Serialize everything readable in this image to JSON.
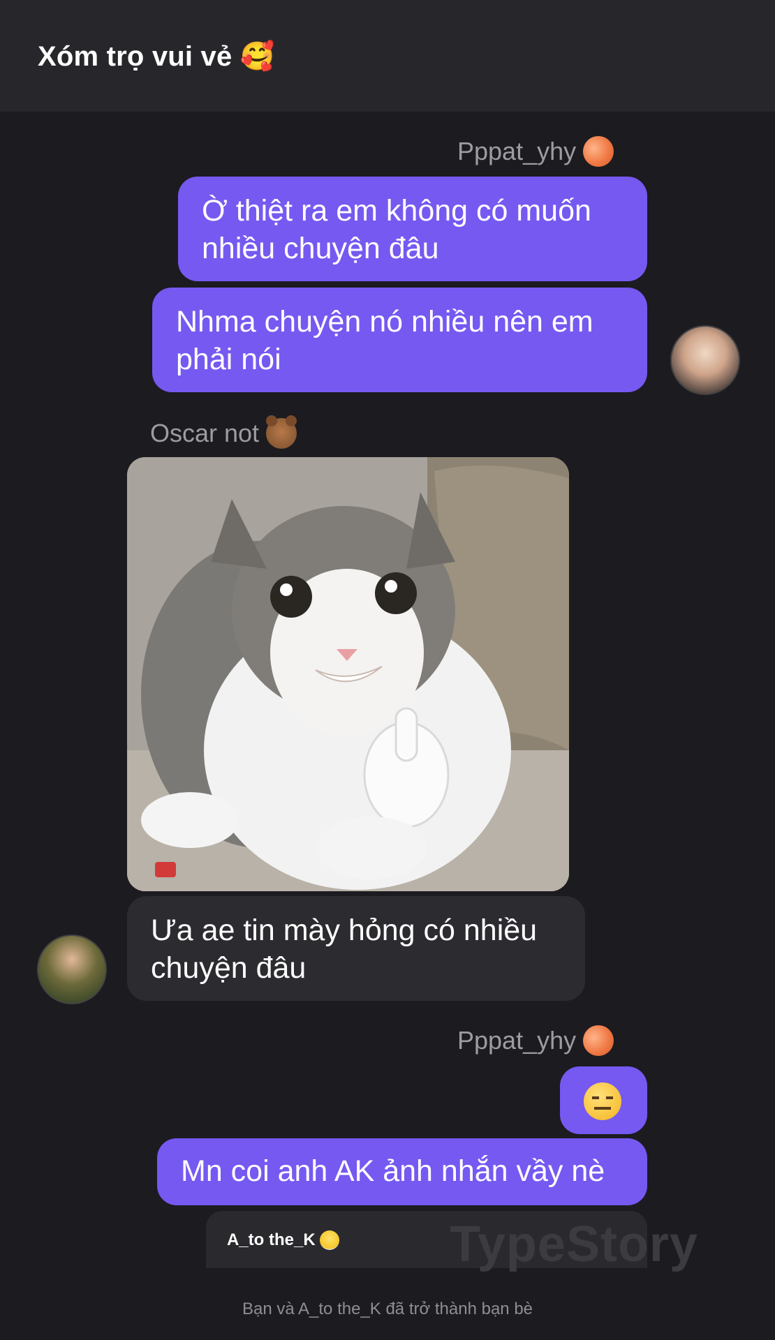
{
  "header": {
    "title": "Xóm trọ vui vẻ 🥰"
  },
  "messages": {
    "group1": {
      "sender": "Pppat_yhy",
      "sender_emoji": "peach-icon",
      "bubble1": "Ờ thiệt ra em không có muốn nhiều chuyện đâu",
      "bubble2": "Nhma chuyện nó nhiều nên em phải nói"
    },
    "group2": {
      "sender": "Oscar not",
      "sender_emoji": "bear-icon",
      "image": "cat-thumbs-up-image",
      "bubble1": "Ưa ae tin mày hỏng có nhiều chuyện đâu"
    },
    "group3": {
      "sender": "Pppat_yhy",
      "sender_emoji": "peach-icon",
      "bubble1_emoji": "expressionless-face-icon",
      "bubble2": "Mn coi anh AK ảnh nhắn vầy nè"
    }
  },
  "preview": {
    "name": "A_to the_K",
    "name_emoji": "hatching-chick-icon"
  },
  "watermark": "TypeStory",
  "system_note": "Bạn và A_to the_K đã trở thành bạn bè",
  "colors": {
    "outgoing_bubble": "#7659f1",
    "incoming_bubble": "#2c2b30",
    "background": "#1c1b20"
  }
}
